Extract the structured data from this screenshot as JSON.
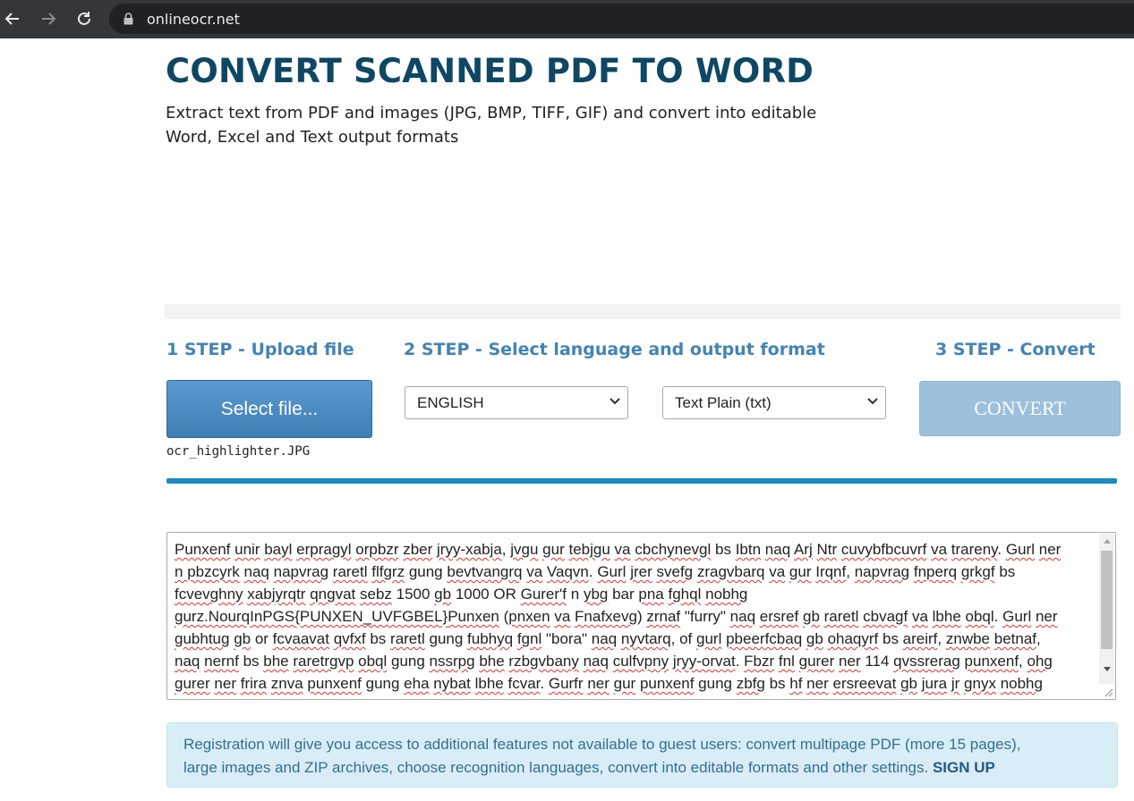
{
  "browser": {
    "url": "onlineocr.net",
    "icons": [
      "back-arrow-icon",
      "forward-arrow-icon",
      "reload-icon",
      "lock-icon"
    ]
  },
  "page": {
    "title": "CONVERT SCANNED PDF TO WORD",
    "subtitle_line1": "Extract text from PDF and images (JPG, BMP, TIFF, GIF) and convert into editable",
    "subtitle_line2": "Word, Excel and Text output formats"
  },
  "steps": {
    "step1": "1 STEP - Upload file",
    "step2": "2 STEP - Select language and output format",
    "step3": "3 STEP - Convert"
  },
  "upload": {
    "button_label": "Select file...",
    "filename": "ocr_highlighter.JPG"
  },
  "language": {
    "selected": "ENGLISH"
  },
  "format": {
    "selected": "Text Plain (txt)"
  },
  "convert": {
    "label": "CONVERT"
  },
  "colors": {
    "title": "#0e4763",
    "step": "#4383b4",
    "button": "#4a8ac2",
    "convert_disabled": "#9dbfdb",
    "progress": "#1a8bc0",
    "notice_bg": "#d9edf7"
  },
  "result": {
    "lines": [
      [
        "Punxenf",
        " ",
        "unir",
        " ",
        "bayl",
        " ",
        "erpragyl",
        " ",
        "orpbzr",
        " ",
        "zber",
        " ",
        "jryy-xabja",
        ", ",
        "jvgu",
        " ",
        "gur",
        " ",
        "tebjgu",
        " ",
        "va",
        " ",
        "cbchynevgl",
        " bs ",
        "Ibtn",
        " ",
        "naq",
        " ",
        "Arj",
        " ",
        "Ntr",
        " ",
        "cuvybfbcuvrf",
        " ",
        "va",
        " ",
        "trareny",
        ". ",
        "Gurl",
        " ",
        "ner"
      ],
      [
        "n ",
        "pbzcyrk",
        " ",
        "naq",
        " ",
        "napvrag",
        " ",
        "raretl",
        " ",
        "flfgrz",
        " gung ",
        "bevtvangrq",
        " ",
        "va",
        " ",
        "Vaqvn",
        ". ",
        "Gurl",
        " ",
        "jrer",
        " ",
        "svefg",
        " ",
        "zragvbarq",
        " ",
        "va",
        " ",
        "gur",
        " ",
        "Irqnf",
        ", ",
        "napvrag",
        " ",
        "fnperq",
        " ",
        "grkgf",
        " bs"
      ],
      [
        "fcvevghny",
        " ",
        "xabjyrqtr",
        " ",
        "qngvat",
        " ",
        "sebz",
        " 1500 ",
        "gb",
        " 1000 OR ",
        "Gurer'f",
        " n ",
        "ybg",
        " bar ",
        "pna",
        " ",
        "fghql",
        " ",
        "nobhg"
      ],
      [
        "gurz.NourqInPGS",
        "{PUNXEN_UVFGBEL}",
        "Punxen",
        " (",
        "pnxen",
        " ",
        "va",
        " ",
        "Fnafxevg",
        ") ",
        "zrnaf",
        " \"furry\" ",
        "naq",
        " ",
        "ersref",
        " ",
        "gb",
        " ",
        "raretl",
        " ",
        "cbvagf",
        " ",
        "va",
        " ",
        "lbhe",
        " ",
        "obql",
        ". ",
        "Gurl",
        " ",
        "ner"
      ],
      [
        "gubhtug",
        " ",
        "gb",
        " or ",
        "fcvaavat",
        " ",
        "qvfxf",
        " bs ",
        "raretl",
        " gung ",
        "fubhyq",
        " ",
        "fgnl",
        " \"bora\" ",
        "naq",
        " ",
        "nyvtarq",
        ", of ",
        "gurl",
        " ",
        "pbeerfcbaq",
        " ",
        "gb",
        " ",
        "ohaqyrf",
        " bs ",
        "areirf",
        ", ",
        "znwbe",
        " ",
        "betnaf",
        ","
      ],
      [
        "naq",
        " ",
        "nernf",
        " bs ",
        "bhe",
        " ",
        "raretrgvp",
        " ",
        "obql",
        " gung ",
        "nssrpg",
        " ",
        "bhe",
        " ",
        "rzbgvbany",
        " ",
        "naq",
        " ",
        "culfvpny",
        " ",
        "jryy-orvat",
        ". ",
        "Fbzr",
        " ",
        "fnl",
        " ",
        "gurer",
        " ",
        "ner",
        " 114 ",
        "qvssrerag",
        " ",
        "punxenf",
        ", ",
        "ohg"
      ],
      [
        "gurer",
        " ",
        "ner",
        " ",
        "frira",
        " ",
        "znva",
        " ",
        "punxenf",
        " gung ",
        "eha",
        " ",
        "nybat",
        " ",
        "lbhe",
        " ",
        "fcvar",
        ". ",
        "Gurfr",
        " ",
        "ner",
        " ",
        "gur",
        " ",
        "punxenf",
        " gung ",
        "zbfg",
        " bs ",
        "hf",
        " ",
        "ner",
        " ",
        "ersreevat",
        " ",
        "gb",
        " ",
        "jura",
        " ",
        "jr",
        " ",
        "gnyx",
        " ",
        "nobhg"
      ]
    ]
  },
  "notice": {
    "line1": "Registration will give you access to additional features not available to guest users: convert multipage PDF (more 15 pages),",
    "line2": "large images and ZIP archives, choose recognition languages, convert into editable formats and other settings.",
    "signup": "SIGN UP"
  }
}
